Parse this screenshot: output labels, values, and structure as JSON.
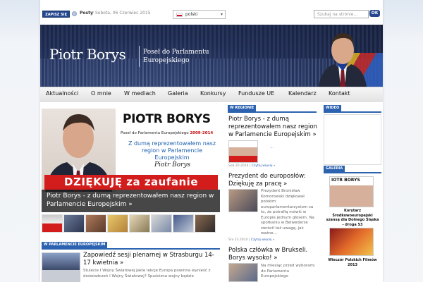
{
  "topbar": {
    "subscribe_label": "ZAPISZ SIĘ",
    "posts_label": "Posty",
    "separator": "/",
    "date": "Sobota, 06 Czerwiec 2015",
    "language": "polski",
    "search_placeholder": "Szukaj na stronie...",
    "search_button": "OK"
  },
  "banner": {
    "name": "Piotr Borys",
    "subtitle_line1": "Poseł do Parlamentu",
    "subtitle_line2": "Europejskiego"
  },
  "nav": {
    "items": [
      "Aktualności",
      "O mnie",
      "W mediach",
      "Galeria",
      "Konkursy",
      "Fundusze UE",
      "Kalendarz",
      "Kontakt"
    ]
  },
  "feature": {
    "heading": "PIOTR BORYS",
    "role": "Poseł do Parlamentu Europejskiego",
    "term": "2009-2014",
    "blue_text": "Z dumą reprezentowałem nasz region w Parlamencie Europejskim",
    "signature": "Piotr Borys",
    "red_banner": "DZIĘKUJĘ za zaufanie",
    "caption": "Piotr Borys - z dumą reprezentowałem nasz region w Parlamencie Europejskim »"
  },
  "section_parlament": {
    "label": "W PARLAMENCIE EUROPEJSKIM",
    "post_title": "Zapowiedź sesji plenarnej w Strasburgu 14-17 kwietnia »",
    "post_body": "Stulecie I Wojny Światowej Jakie lekcje Europa powinna wynieść z doświadczeń I Wojny Światowej? Spuścizna wojny będzie"
  },
  "section_region": {
    "label": "W REGIONIE",
    "post1_title": "Piotr Borys - z dumą reprezentowałem nasz region w Parlamencie Europejskim »",
    "post1_ellipsis": "...",
    "post1_date": "Sob 20.2014",
    "post1_more": "Czytaj więcej »",
    "post2_title": "Prezydent do europosłów: Dziękuję za pracę »",
    "post2_body": "Prezydent Bronisław Komorowski dziękował polskim europarlamentarzystom za to, że potrafią mówić w Europie jednym głosem. Na spotkaniu w Belwederze zwrócił też uwagę, jak ważne...",
    "post2_date": "Śro 23.2014",
    "post2_more": "Czytaj więcej »",
    "post3_title": "Polska człówka w Brukseli. Borys wysoko! »",
    "post3_body": "Na miesiąc przed wyborami do Parlamentu Europejskiego"
  },
  "sidebar": {
    "video_label": "WIDEO",
    "gallery_label": "GALERIA",
    "gallery1_thumb_text": "IOTR BORYS",
    "gallery1_caption": "Korytarz Środkowoeuropejski szansą dla Dolnego Śląska - droga S3",
    "gallery2_caption": "Wieczór Polskich Filmów 2013"
  },
  "colors": {
    "brand_blue": "#2c62b0",
    "red": "#d31c1c"
  }
}
